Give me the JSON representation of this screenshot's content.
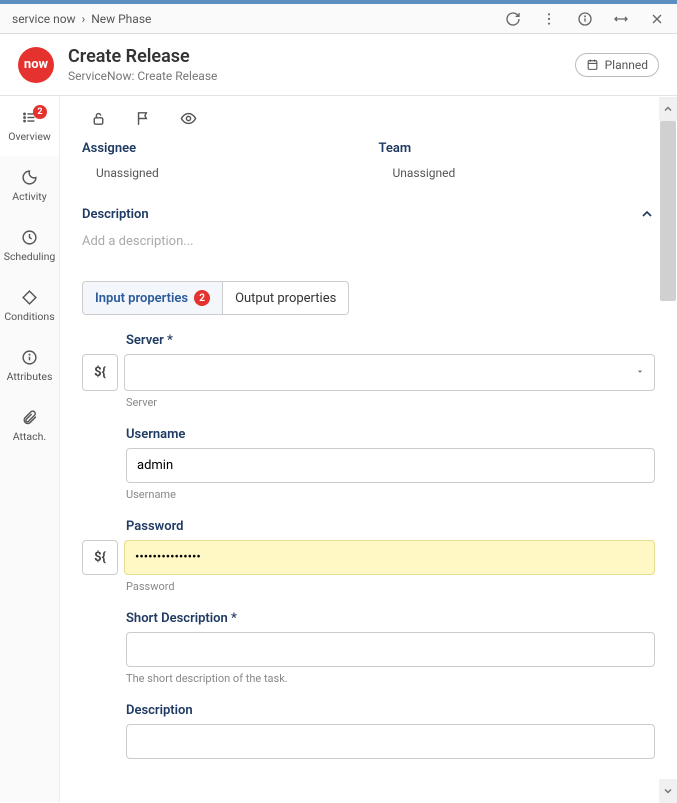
{
  "breadcrumb": {
    "root": "service now",
    "current": "New Phase"
  },
  "header": {
    "logo_text": "now",
    "title": "Create Release",
    "subtitle": "ServiceNow: Create Release",
    "status_label": "Planned"
  },
  "sidebar": {
    "overview": {
      "label": "Overview",
      "badge": "2"
    },
    "activity": {
      "label": "Activity"
    },
    "scheduling": {
      "label": "Scheduling"
    },
    "conditions": {
      "label": "Conditions"
    },
    "attributes": {
      "label": "Attributes"
    },
    "attach": {
      "label": "Attach."
    }
  },
  "assign": {
    "assignee_label": "Assignee",
    "assignee_value": "Unassigned",
    "team_label": "Team",
    "team_value": "Unassigned"
  },
  "description": {
    "label": "Description",
    "placeholder": "Add a description..."
  },
  "tabs": {
    "input": "Input properties",
    "input_badge": "2",
    "output": "Output properties"
  },
  "form": {
    "server": {
      "label": "Server *",
      "help": "Server"
    },
    "username": {
      "label": "Username",
      "value": "admin",
      "help": "Username"
    },
    "password": {
      "label": "Password",
      "value": "•••••••••••••••",
      "help": "Password"
    },
    "shortdesc": {
      "label": "Short Description *",
      "help": "The short description of the task."
    },
    "desc2": {
      "label": "Description"
    }
  },
  "variable_token": "${"
}
